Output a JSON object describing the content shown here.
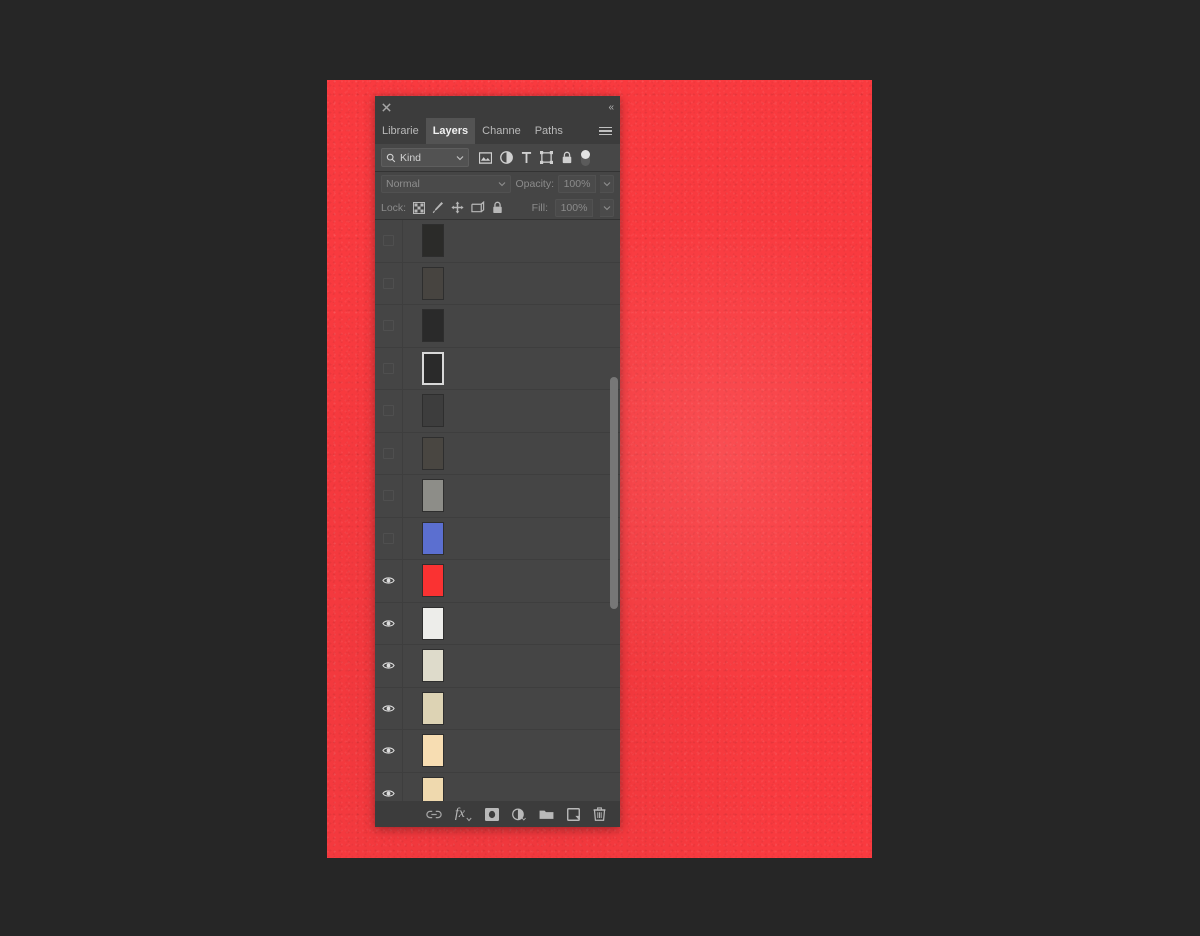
{
  "canvas": {
    "background_color": "#262626",
    "artwork_color": "#f93a3f"
  },
  "panel": {
    "title_bar": {
      "close_icon": "close-icon",
      "collapse_label": "«"
    },
    "tabs": [
      {
        "label": "Librarie",
        "active": false
      },
      {
        "label": "Layers",
        "active": true
      },
      {
        "label": "Channe",
        "active": false
      },
      {
        "label": "Paths",
        "active": false
      }
    ],
    "menu_icon": "hamburger-menu-icon",
    "filter_row": {
      "search_icon": "search-icon",
      "kind_value": "Kind",
      "caret": "⌄",
      "icons": [
        "pixel-layer-filter-icon",
        "adjustment-layer-filter-icon",
        "type-layer-filter-icon",
        "shape-layer-filter-icon",
        "smart-object-filter-icon"
      ],
      "toggle": "filter-enable-toggle"
    },
    "blend_row": {
      "blend_mode": "Normal",
      "opacity_label": "Opacity:",
      "opacity_value": "100%"
    },
    "lock_row": {
      "lock_label": "Lock:",
      "icons": [
        "lock-transparent-pixels-icon",
        "lock-image-pixels-icon",
        "lock-position-icon",
        "lock-artboard-nesting-icon",
        "lock-all-icon"
      ],
      "fill_label": "Fill:",
      "fill_value": "100%"
    },
    "layers": [
      {
        "visible": false,
        "thumb": "#2b2b29",
        "framed": false
      },
      {
        "visible": false,
        "thumb": "#474440",
        "framed": false
      },
      {
        "visible": false,
        "thumb": "#2a2a2a",
        "framed": false
      },
      {
        "visible": false,
        "thumb": "#2a2a2a",
        "framed": true
      },
      {
        "visible": false,
        "thumb": "#3d3d3d",
        "framed": false
      },
      {
        "visible": false,
        "thumb": "#494641",
        "framed": false
      },
      {
        "visible": false,
        "thumb": "#8d8d88",
        "framed": false
      },
      {
        "visible": false,
        "thumb": "#5b6fd0",
        "framed": false
      },
      {
        "visible": true,
        "thumb": "#fa3232",
        "framed": false
      },
      {
        "visible": true,
        "thumb": "#ededea",
        "framed": false
      },
      {
        "visible": true,
        "thumb": "#dedbcb",
        "framed": false
      },
      {
        "visible": true,
        "thumb": "#ddd3b4",
        "framed": false
      },
      {
        "visible": true,
        "thumb": "#f7ddb2",
        "framed": false
      },
      {
        "visible": true,
        "thumb": "#efd9ae",
        "framed": false
      }
    ],
    "scrollbar": {
      "thumb_top_pct": 27,
      "thumb_height_pct": 40
    },
    "bottom_bar": {
      "icons": [
        "link-layers-icon",
        "layer-style-fx-icon",
        "add-layer-mask-icon",
        "new-adjustment-layer-icon",
        "new-group-folder-icon",
        "new-layer-icon",
        "delete-layer-trash-icon"
      ],
      "fx_label": "fx"
    }
  }
}
